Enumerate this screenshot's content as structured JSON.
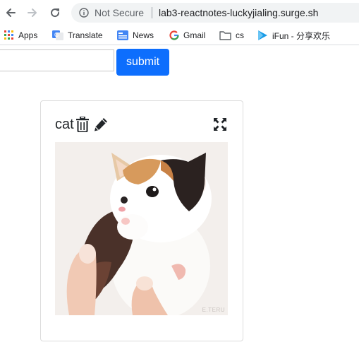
{
  "browser": {
    "address_bar": {
      "security_label": "Not Secure",
      "url": "lab3-reactnotes-luckyjialing.surge.sh"
    },
    "bookmarks": [
      {
        "label": "Apps",
        "icon": "apps-grid-icon"
      },
      {
        "label": "Translate",
        "icon": "translate-icon"
      },
      {
        "label": "News",
        "icon": "news-icon"
      },
      {
        "label": "Gmail",
        "icon": "google-g-icon"
      },
      {
        "label": "cs",
        "icon": "folder-icon"
      },
      {
        "label": "iFun - 分享欢乐",
        "icon": "play-icon"
      }
    ]
  },
  "form": {
    "input_value": "",
    "submit_label": "submit"
  },
  "notes": [
    {
      "title": "cat",
      "image_watermark": "E.TERU",
      "icons": [
        "trash-icon",
        "pencil-icon",
        "expand-icon"
      ]
    }
  ],
  "colors": {
    "submit_blue": "#0d6efd",
    "card_border": "#dcdcdc",
    "omnibox_bg": "#f1f3f4"
  }
}
